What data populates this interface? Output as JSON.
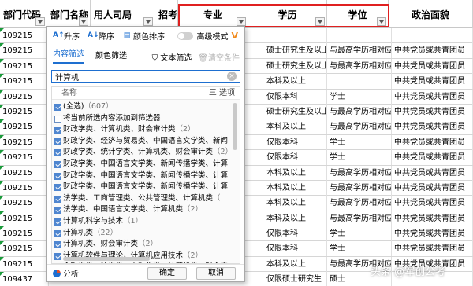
{
  "columns": {
    "dept_code": "部门代码",
    "dept_name": "部门名称",
    "employer": "用人司局",
    "recruit": "招考人",
    "major": "专业",
    "education": "学历",
    "degree": "学位",
    "political": "政治面貌"
  },
  "rows": [
    {
      "code": "109215",
      "major": "",
      "edu": "",
      "deg": "",
      "pol": ""
    },
    {
      "code": "109215",
      "major": "硕士研究生及以上",
      "edu": "与最高学历相对应",
      "deg": "中共党员或共青团员",
      "pol": ""
    },
    {
      "code": "109215",
      "major": "硕士研究生及以上",
      "edu": "与最高学历相对应",
      "deg": "中共党员或共青团员",
      "pol": ""
    },
    {
      "code": "109215",
      "major": "本科及以上",
      "edu": "",
      "deg": "中共党员或共青团员",
      "pol": ""
    },
    {
      "code": "109215",
      "major": "仅限本科",
      "edu": "学士",
      "deg": "中共党员或共青团员",
      "pol": ""
    },
    {
      "code": "109215",
      "major": "硕士研究生及以上",
      "edu": "与最高学历相对应",
      "deg": "中共党员或共青团员",
      "pol": ""
    },
    {
      "code": "109215",
      "major": "本科及以上",
      "edu": "与最高学历相对应",
      "deg": "中共党员或共青团员",
      "pol": ""
    },
    {
      "code": "109215",
      "major": "仅限本科",
      "edu": "学士",
      "deg": "中共党员或共青团员",
      "pol": ""
    },
    {
      "code": "109215",
      "major": "仅限本科",
      "edu": "学士",
      "deg": "中共党员或共青团员",
      "pol": ""
    },
    {
      "code": "109215",
      "major": "本科及以上",
      "edu": "与最高学历相对应",
      "deg": "中共党员或共青团员",
      "pol": ""
    },
    {
      "code": "109215",
      "major": "本科及以上",
      "edu": "与最高学历相对应",
      "deg": "中共党员或共青团员",
      "pol": ""
    },
    {
      "code": "109215",
      "major": "本科及以上",
      "edu": "与最高学历相对应",
      "deg": "中共党员或共青团员",
      "pol": ""
    },
    {
      "code": "109215",
      "major": "本科及以上",
      "edu": "与最高学历相对应",
      "deg": "中共党员或共青团员",
      "pol": ""
    },
    {
      "code": "109215",
      "major": "仅限本科",
      "edu": "学士",
      "deg": "中共党员或共青团员",
      "pol": ""
    },
    {
      "code": "109215",
      "major": "仅限本科",
      "edu": "学士",
      "deg": "中共党员或共青团员",
      "pol": ""
    },
    {
      "code": "109215",
      "major": "本科及以上",
      "edu": "与最高学历相对应",
      "deg": "中共党员或共青团员",
      "pol": ""
    },
    {
      "code": "109437",
      "major": "仅限硕士研究生",
      "edu": "硕士",
      "deg": "",
      "pol": ""
    }
  ],
  "filter_popup": {
    "sort_asc": "升序",
    "sort_desc": "降序",
    "sort_color": "颜色排序",
    "advanced_mode": "高级模式",
    "tab_content": "内容筛选",
    "tab_color": "颜色筛选",
    "text_filter": "文本筛选",
    "clear_condition": "清空条件",
    "search_value": "计算机",
    "list_header": "名称",
    "options_label": "三 选项",
    "items": [
      {
        "label": "(全选)",
        "count": "（607）",
        "checked": true
      },
      {
        "label": "将当前所选内容添加到筛选器",
        "count": "",
        "checked": false
      },
      {
        "label": "财政学类、计算机类、财会审计类",
        "count": "（2）",
        "checked": true
      },
      {
        "label": "财政学类、经济与贸易类、中国语言文学类、新闻",
        "count": "",
        "checked": true
      },
      {
        "label": "财政学类、统计学类、计算机类、财会审计类",
        "count": "（2）",
        "checked": true
      },
      {
        "label": "财政学类、中国语言文学类、新闻传播学类、计算",
        "count": "",
        "checked": true
      },
      {
        "label": "财政学类、中国语言文学类、新闻传播学类、计算",
        "count": "",
        "checked": true
      },
      {
        "label": "财政学类、中国语言文学类、新闻传播学类、计算",
        "count": "",
        "checked": true
      },
      {
        "label": "法学类、工商管理类、公共管理类、计算机类",
        "count": "（",
        "checked": true
      },
      {
        "label": "法学类、中国语言文学类、计算机类",
        "count": "（2）",
        "checked": true
      },
      {
        "label": "计算机科学与技术",
        "count": "（1）",
        "checked": true
      },
      {
        "label": "计算机类",
        "count": "（22）",
        "checked": true
      },
      {
        "label": "计算机类、财会审计类",
        "count": "（2）",
        "checked": true
      },
      {
        "label": "计算机软件与理论，计算机应用技术",
        "count": "（2）",
        "checked": true
      },
      {
        "label": "金融学类、法学类、自动化类、计算机类、财会审",
        "count": "",
        "checked": true
      }
    ],
    "analyze": "分析",
    "ok": "确定",
    "cancel": "取消"
  },
  "watermark": "头条 @军创公考",
  "colors": {
    "accent": "#1e6fd0",
    "highlight_box": "#e02020",
    "corner_mark": "#1a9a3a"
  }
}
